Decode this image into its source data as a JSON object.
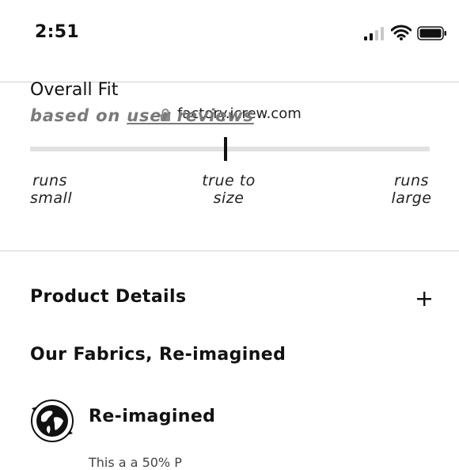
{
  "status_bar": {
    "time": "2:51",
    "icons": [
      "signal-icon",
      "wifi-icon",
      "battery-icon"
    ]
  },
  "browser": {
    "url": "factory.jcrew.com",
    "icons": [
      "lock-icon"
    ]
  },
  "fit": {
    "title": "Overall Fit",
    "subtitle_prefix": "based on",
    "subtitle_link": "user reviews",
    "marker_position_fraction": 0.49,
    "labels": {
      "left_line1": "runs",
      "left_line2": "small",
      "mid_line1": "true to",
      "mid_line2": "size",
      "right_line1": "runs",
      "right_line2": "large"
    }
  },
  "product_details": {
    "label": "Product Details",
    "expand_icon": "plus-icon"
  },
  "fabrics": {
    "heading": "Our Fabrics, Re-imagined",
    "item_label": "Re-imagined",
    "item_icon": "globe-recycle-icon",
    "body_text_partial": "This    a    a    50%    P"
  },
  "colors": {
    "text": "#111111",
    "subtle_text": "#7a7a7a",
    "track": "#e1e1e1",
    "divider": "#d3d3d3"
  }
}
